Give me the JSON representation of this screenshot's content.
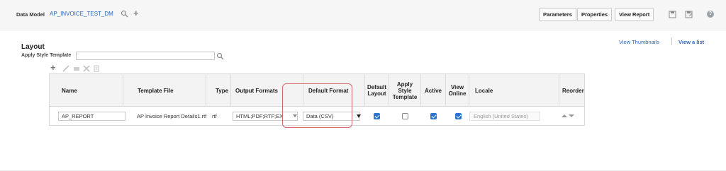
{
  "header": {
    "data_model_label": "Data Model",
    "data_model_name": "AP_INVOICE_TEST_DM",
    "buttons": {
      "parameters": "Parameters",
      "properties": "Properties",
      "view_report": "View Report"
    },
    "icons": [
      "search-icon",
      "add-icon",
      "save-icon",
      "save-as-icon",
      "help-icon"
    ]
  },
  "view_links": {
    "thumbnails": "View Thumbnails",
    "list": "View a list"
  },
  "layout": {
    "title": "Layout",
    "apply_style_label": "Apply Style Template",
    "apply_style_value": ""
  },
  "table": {
    "columns": [
      "Name",
      "Template File",
      "Type",
      "Output Formats",
      "Default Format",
      "Default Layout",
      "Apply Style Template",
      "Active",
      "View Online",
      "Locale",
      "Reorder"
    ],
    "rows": [
      {
        "name": "AP_REPORT",
        "template_file": "AP Invoice Report Details1.rtf",
        "type": "rtf",
        "output_formats": "HTML;PDF;RTF;EX",
        "default_format": "Data (CSV)",
        "default_layout": true,
        "apply_style_template": false,
        "active": true,
        "view_online": true,
        "locale": "English (United States)"
      }
    ]
  },
  "colors": {
    "link": "#2a66b8",
    "checkbox": "#2a74d0",
    "highlight": "#d9686b"
  }
}
